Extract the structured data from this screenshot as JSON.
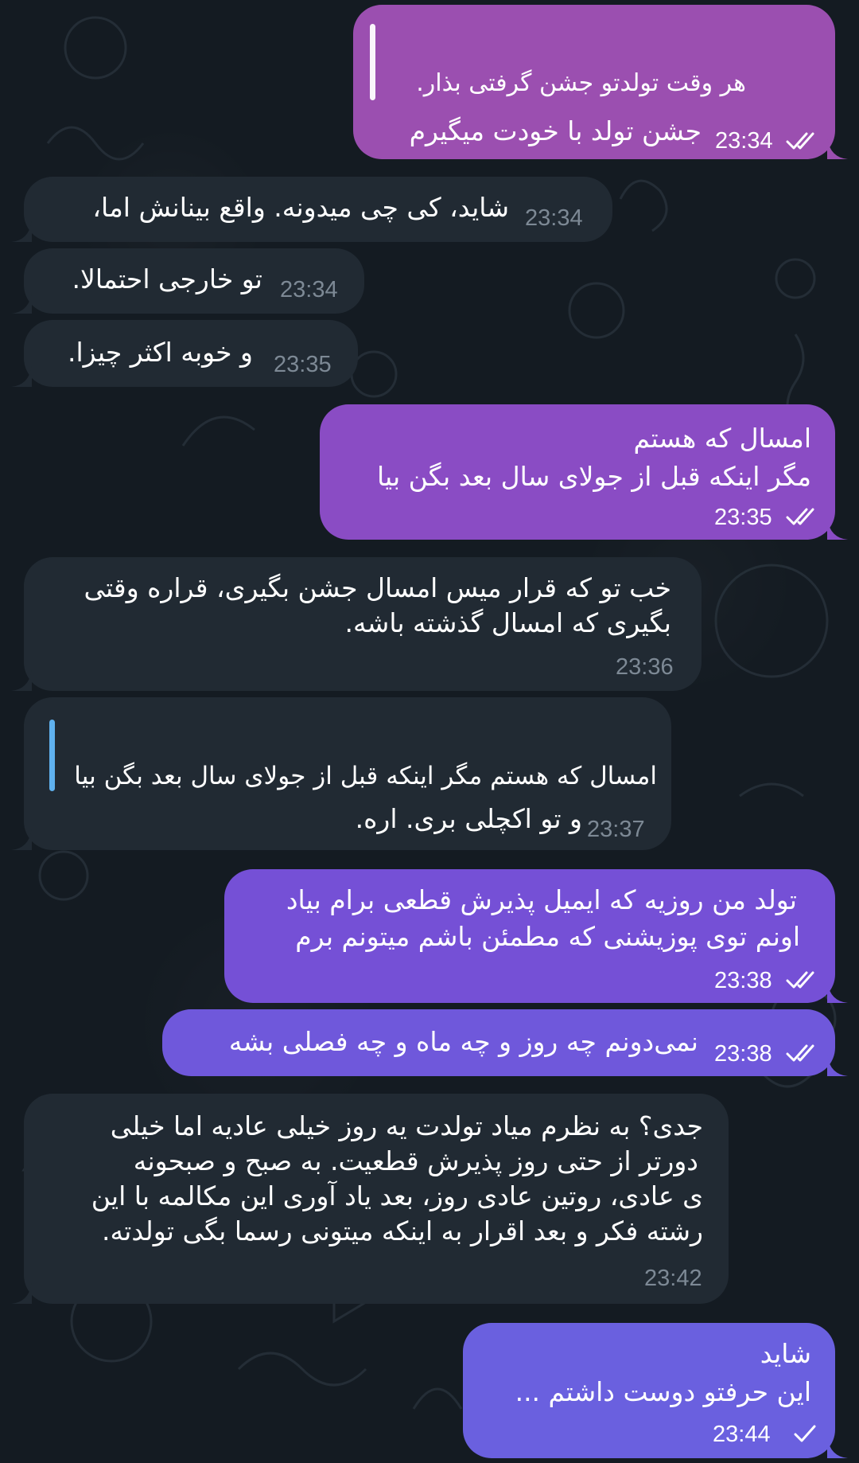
{
  "colors": {
    "background": "#141b22",
    "incoming_bubble": "#212a33",
    "outgoing_1": "#9b4fb0",
    "outgoing_2": "#8a4cc4",
    "outgoing_3": "#7550d6",
    "outgoing_4": "#6a60df",
    "quote_bar_in": "#5fb1ee",
    "quote_bar_out": "#ffffff",
    "time_in": "#7d8995",
    "time_out": "#ffffff"
  },
  "messages": [
    {
      "direction": "out",
      "quote": "",
      "reply_text": "هر وقت تولدتو جشن گرفتی بذار.",
      "text": "جشن تولد با خودت میگیرم",
      "time": "23:34",
      "status": "read-double-check-icon"
    },
    {
      "direction": "in",
      "text": "شاید، کی چی میدونه. واقع بینانش اما،",
      "time": "23:34"
    },
    {
      "direction": "in",
      "text": "تو خارجی احتمالا.",
      "time": "23:34"
    },
    {
      "direction": "in",
      "text": "و خوبه اکثر چیزا.",
      "time": "23:35"
    },
    {
      "direction": "out",
      "lines": [
        "امسال که هستم",
        "مگر اینکه قبل از جولای سال بعد بگن بیا"
      ],
      "time": "23:35",
      "status": "read-double-check-icon"
    },
    {
      "direction": "in",
      "lines": [
        "خب تو که قرار میس امسال جشن بگیری، قراره وقتی",
        "بگیری که امسال گذشته باشه."
      ],
      "time": "23:36"
    },
    {
      "direction": "in",
      "quote": "امسال که هستم مگر اینکه قبل از جولای سال بعد بگن بیا",
      "text": "و تو اکچلی بری. اره.",
      "time": "23:37"
    },
    {
      "direction": "out",
      "lines": [
        "تولد من روزیه که ایمیل پذیرش قطعی برام بیاد",
        "اونم توی پوزیشنی که مطمئن باشم میتونم برم"
      ],
      "time": "23:38",
      "status": "read-double-check-icon"
    },
    {
      "direction": "out",
      "text": "نمی‌دونم چه روز و چه ماه و چه فصلی بشه",
      "time": "23:38",
      "status": "read-double-check-icon"
    },
    {
      "direction": "in",
      "lines": [
        "جدی؟ به نظرم میاد تولدت یه روز خیلی عادیه اما خیلی",
        "دورتر از حتی روز پذیرش قطعیت. به صبح و صبحونه",
        "ی عادی، روتین عادی روز، بعد یاد آوری این مکالمه با این",
        "رشته فکر و بعد اقرار به اینکه میتونی رسما بگی تولدته."
      ],
      "time": "23:42"
    },
    {
      "direction": "out",
      "lines": [
        "شاید",
        "این حرفتو دوست داشتم ..."
      ],
      "time": "23:44",
      "status": "sent-single-check-icon"
    }
  ]
}
